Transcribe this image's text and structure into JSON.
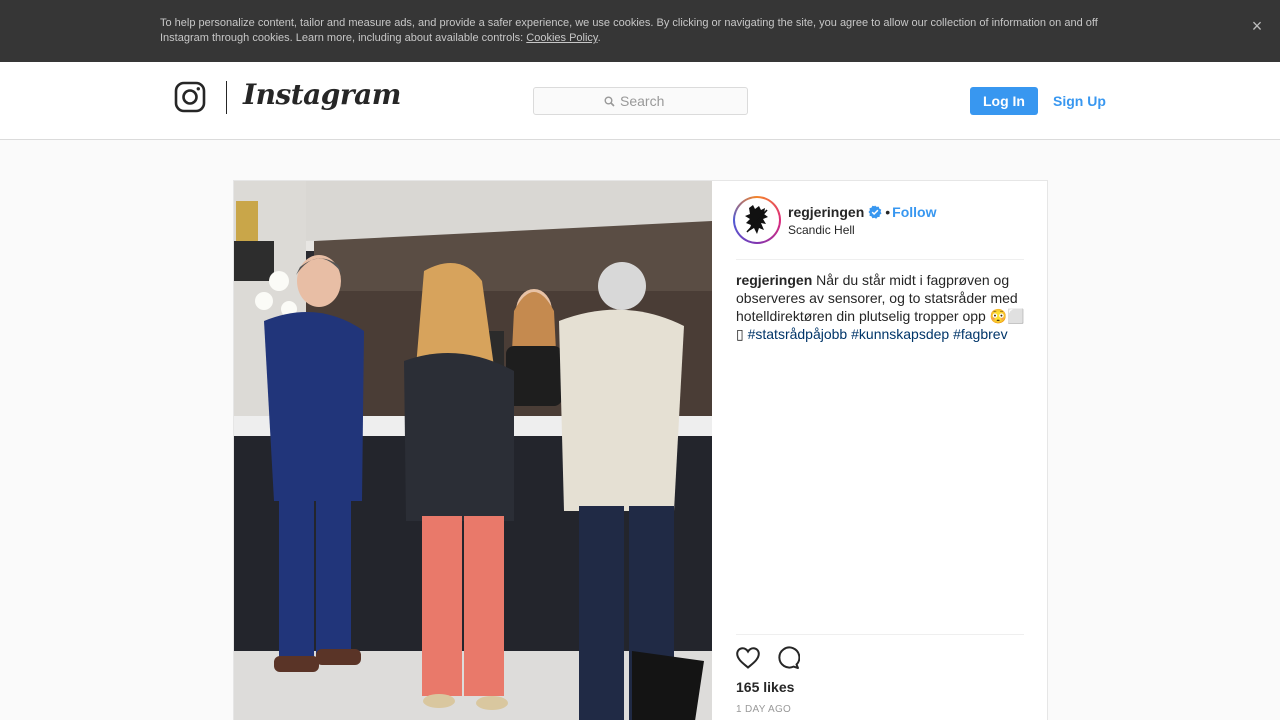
{
  "cookie_banner": {
    "text": "To help personalize content, tailor and measure ads, and provide a safer experience, we use cookies. By clicking or navigating the site, you agree to allow our collection of information on and off Instagram through cookies. Learn more, including about available controls: ",
    "link": "Cookies Policy",
    "period": ".",
    "close": "×"
  },
  "nav": {
    "wordmark": "Instagram",
    "search_placeholder": "Search",
    "login": "Log In",
    "signup": "Sign Up"
  },
  "post": {
    "username": "regjeringen",
    "separator": "•",
    "follow": "Follow",
    "location": "Scandic Hell",
    "caption_user": "regjeringen",
    "caption_text": " Når du står midt i fagprøven og observeres av sensorer, og to statsråder med hotelldirektøren din plutselig tropper opp 😳⬜ ▯ ",
    "hashtags": [
      "#statsrådpåjobb",
      "#kunnskapsdep",
      "#fagbrev"
    ],
    "likes": "165 likes",
    "time": "1 DAY AGO"
  },
  "icons": {
    "logo": "instagram-camera-icon",
    "search": "search-icon",
    "verified": "verified-badge-icon",
    "like": "heart-icon",
    "comment": "comment-icon",
    "close": "close-icon"
  },
  "colors": {
    "accent": "#3897f0",
    "hashtag": "#003569",
    "banner": "#363636"
  }
}
